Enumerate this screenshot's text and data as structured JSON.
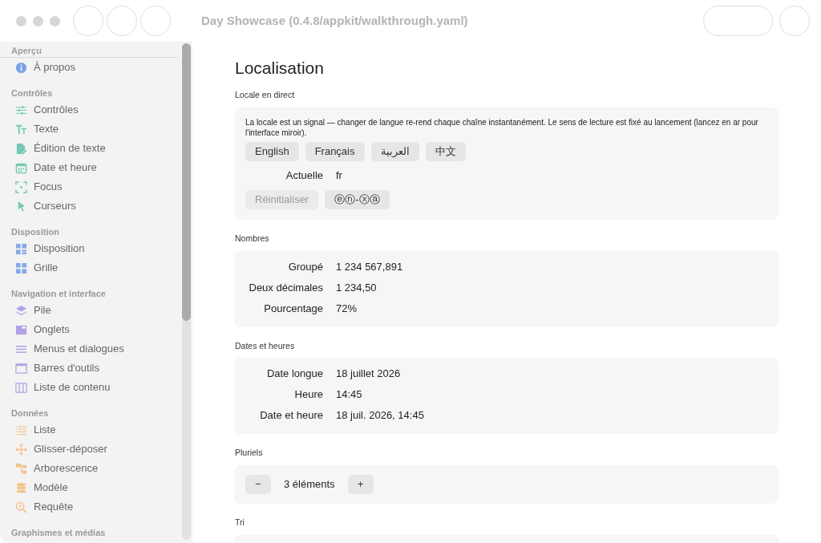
{
  "window": {
    "title": "Day Showcase (0.4.8/appkit/walkthrough.yaml)"
  },
  "sidebar": {
    "groups": [
      {
        "title": "Aperçu",
        "color": "#7aa3e6",
        "items": [
          {
            "label": "À propos"
          }
        ]
      },
      {
        "title": "Contrôles",
        "color": "#74c9b4",
        "items": [
          {
            "label": "Contrôles"
          },
          {
            "label": "Texte"
          },
          {
            "label": "Édition de texte"
          },
          {
            "label": "Date et heure"
          },
          {
            "label": "Focus"
          },
          {
            "label": "Curseurs"
          }
        ]
      },
      {
        "title": "Disposition",
        "color": "#86a9ec",
        "items": [
          {
            "label": "Disposition"
          },
          {
            "label": "Grille"
          }
        ]
      },
      {
        "title": "Navigation et interface",
        "color": "#b3a1e6",
        "items": [
          {
            "label": "Pile"
          },
          {
            "label": "Onglets"
          },
          {
            "label": "Menus et dialogues"
          },
          {
            "label": "Barres d'outils"
          },
          {
            "label": "Liste de contenu"
          }
        ]
      },
      {
        "title": "Données",
        "color": "#f3c48f",
        "items": [
          {
            "label": "Liste"
          },
          {
            "label": "Glisser-déposer"
          },
          {
            "label": "Arborescence"
          },
          {
            "label": "Modèle"
          },
          {
            "label": "Requête"
          }
        ]
      },
      {
        "title": "Graphismes et médias"
      }
    ]
  },
  "page": {
    "title": "Localisation",
    "sections": [
      {
        "kind": "locale",
        "title": "Locale en direct",
        "description": "La locale est un signal — changer de langue re-rend chaque chaîne instantanément. Le sens de lecture est fixé au lancement (lancez en ar pour l'interface miroir).",
        "languages": [
          {
            "label": "English"
          },
          {
            "label": "Français"
          },
          {
            "label": "العربية"
          },
          {
            "label": "中文"
          }
        ],
        "rows": [
          {
            "label": "Actuelle",
            "value": "fr"
          }
        ],
        "actions": [
          {
            "label": "Réinitialiser",
            "disabled": true
          },
          {
            "label": "ⓔⓝ-ⓧⓐ",
            "disabled": false
          }
        ]
      },
      {
        "kind": "rows",
        "title": "Nombres",
        "rows": [
          {
            "label": "Groupé",
            "value": "1 234 567,891"
          },
          {
            "label": "Deux décimales",
            "value": "1 234,50"
          },
          {
            "label": "Pourcentage",
            "value": "72%"
          }
        ]
      },
      {
        "kind": "rows",
        "title": "Dates et heures",
        "rows": [
          {
            "label": "Date longue",
            "value": "18 juillet 2026"
          },
          {
            "label": "Heure",
            "value": "14:45"
          },
          {
            "label": "Date et heure",
            "value": "18 juil. 2026, 14:45"
          }
        ]
      },
      {
        "kind": "stepper",
        "title": "Pluriels",
        "minus": "−",
        "count": "3 éléments",
        "plus": "+"
      },
      {
        "kind": "empty",
        "title": "Tri"
      }
    ]
  }
}
